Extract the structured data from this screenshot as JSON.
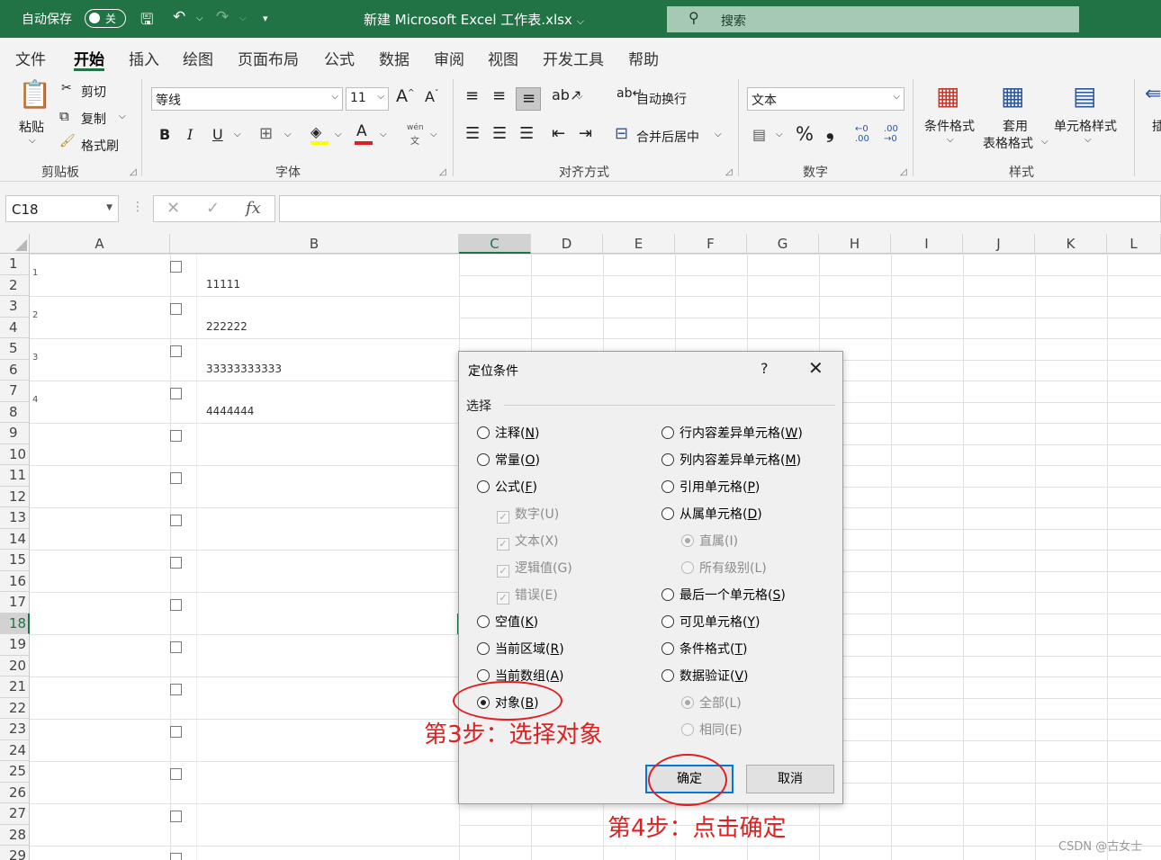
{
  "titlebar": {
    "autosave_label": "自动保存",
    "autosave_state": "关",
    "document_title": "新建 Microsoft Excel 工作表.xlsx",
    "search_placeholder": "搜索"
  },
  "ribbon_tabs": [
    "文件",
    "开始",
    "插入",
    "绘图",
    "页面布局",
    "公式",
    "数据",
    "审阅",
    "视图",
    "开发工具",
    "帮助"
  ],
  "ribbon": {
    "clipboard": {
      "paste": "粘贴",
      "cut": "剪切",
      "copy": "复制",
      "format_painter": "格式刷",
      "group": "剪贴板"
    },
    "font": {
      "font_name": "等线",
      "font_size": "11",
      "bold": "B",
      "italic": "I",
      "underline": "U",
      "phonetic_top": "wén",
      "phonetic_bottom": "文",
      "font_color_glyph": "A",
      "grow_glyph": "A",
      "shrink_glyph": "A",
      "group": "字体"
    },
    "alignment": {
      "wrap_text": "自动换行",
      "merge_center": "合并后居中",
      "group": "对齐方式"
    },
    "number": {
      "format": "文本",
      "percent": "%",
      "comma": "❟",
      "inc_decimal": ".00",
      "dec_decimal": ".00",
      "group": "数字"
    },
    "styles": {
      "conditional_formatting": "条件格式",
      "format_as_table_line1": "套用",
      "format_as_table_line2": "表格格式",
      "cell_styles": "单元格样式",
      "group": "样式"
    },
    "cells": {
      "insert_partial": "插"
    }
  },
  "formula_bar": {
    "name_box": "C18",
    "fx": "fx",
    "formula": ""
  },
  "sheet": {
    "columns": [
      "A",
      "B",
      "C",
      "D",
      "E",
      "F",
      "G",
      "H",
      "I",
      "J",
      "K",
      "L"
    ],
    "selected_column": "C",
    "rows": [
      "1",
      "2",
      "3",
      "4",
      "5",
      "6",
      "7",
      "8",
      "9",
      "10",
      "11",
      "12",
      "13",
      "14",
      "15",
      "16",
      "17",
      "18",
      "19",
      "20",
      "21",
      "22",
      "23",
      "24",
      "25",
      "26",
      "27",
      "28",
      "29"
    ],
    "selected_row": "18",
    "a_column_numbers": [
      "1",
      "2",
      "3",
      "4"
    ],
    "b_values": [
      "11111",
      "222222",
      "33333333333",
      "4444444"
    ]
  },
  "dialog": {
    "title": "定位条件",
    "help": "?",
    "close": "✕",
    "section": "选择",
    "left_options": [
      {
        "label": "注释",
        "key": "N",
        "type": "radio",
        "checked": false,
        "disabled": false
      },
      {
        "label": "常量",
        "key": "O",
        "type": "radio",
        "checked": false,
        "disabled": false
      },
      {
        "label": "公式",
        "key": "F",
        "type": "radio",
        "checked": false,
        "disabled": false
      },
      {
        "label": "数字(U)",
        "key": "",
        "type": "check",
        "checked": true,
        "disabled": true
      },
      {
        "label": "文本(X)",
        "key": "",
        "type": "check",
        "checked": true,
        "disabled": true
      },
      {
        "label": "逻辑值(G)",
        "key": "",
        "type": "check",
        "checked": true,
        "disabled": true
      },
      {
        "label": "错误(E)",
        "key": "",
        "type": "check",
        "checked": true,
        "disabled": true
      },
      {
        "label": "空值",
        "key": "K",
        "type": "radio",
        "checked": false,
        "disabled": false
      },
      {
        "label": "当前区域",
        "key": "R",
        "type": "radio",
        "checked": false,
        "disabled": false
      },
      {
        "label": "当前数组",
        "key": "A",
        "type": "radio",
        "checked": false,
        "disabled": false
      },
      {
        "label": "对象",
        "key": "B",
        "type": "radio",
        "checked": true,
        "disabled": false
      }
    ],
    "right_options": [
      {
        "label": "行内容差异单元格",
        "key": "W",
        "type": "radio",
        "checked": false,
        "disabled": false
      },
      {
        "label": "列内容差异单元格",
        "key": "M",
        "type": "radio",
        "checked": false,
        "disabled": false
      },
      {
        "label": "引用单元格",
        "key": "P",
        "type": "radio",
        "checked": false,
        "disabled": false
      },
      {
        "label": "从属单元格",
        "key": "D",
        "type": "radio",
        "checked": false,
        "disabled": false
      },
      {
        "label": "直属(I)",
        "key": "",
        "type": "radio",
        "checked": true,
        "disabled": true
      },
      {
        "label": "所有级别(L)",
        "key": "",
        "type": "radio",
        "checked": false,
        "disabled": true
      },
      {
        "label": "最后一个单元格",
        "key": "S",
        "type": "radio",
        "checked": false,
        "disabled": false
      },
      {
        "label": "可见单元格",
        "key": "Y",
        "type": "radio",
        "checked": false,
        "disabled": false
      },
      {
        "label": "条件格式",
        "key": "T",
        "type": "radio",
        "checked": false,
        "disabled": false
      },
      {
        "label": "数据验证",
        "key": "V",
        "type": "radio",
        "checked": false,
        "disabled": false
      },
      {
        "label": "全部(L)",
        "key": "",
        "type": "radio",
        "checked": true,
        "disabled": true
      },
      {
        "label": "相同(E)",
        "key": "",
        "type": "radio",
        "checked": false,
        "disabled": true
      }
    ],
    "ok": "确定",
    "cancel": "取消"
  },
  "annotations": {
    "step3": "第3步：选择对象",
    "step4": "第4步：点击确定",
    "color": "#e02020"
  },
  "watermark": "CSDN @古女士"
}
